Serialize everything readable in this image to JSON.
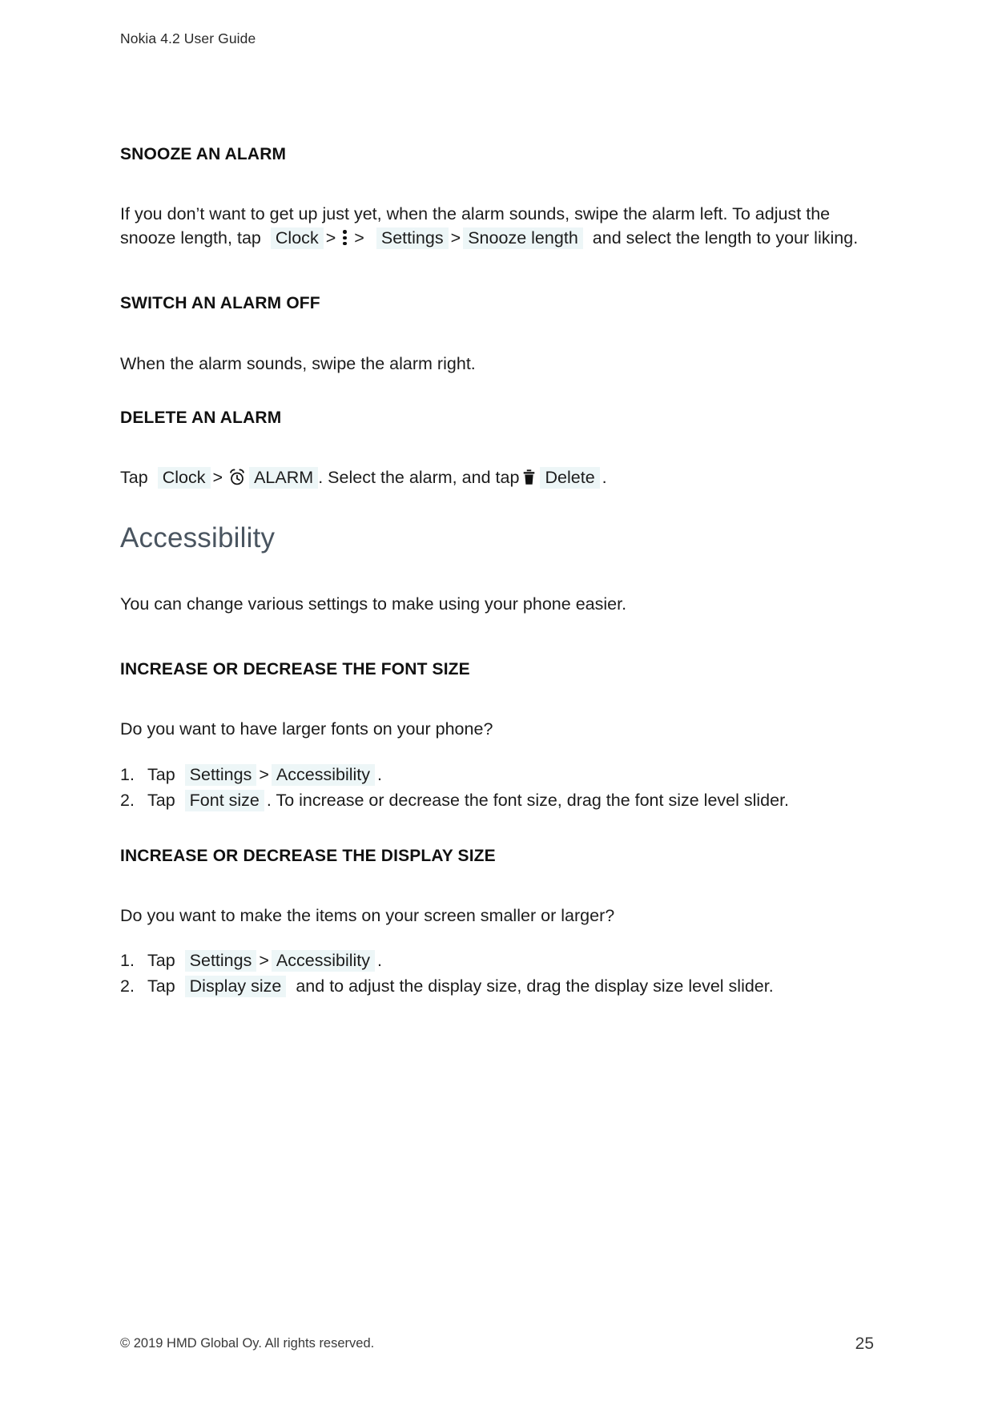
{
  "document": {
    "running_header": "Nokia 4.2 User Guide",
    "page_number": "25",
    "copyright": "© 2019 HMD Global Oy. All rights reserved."
  },
  "colors": {
    "ui_reference_highlight": "#edf6f7",
    "section_title": "#4a5560",
    "body_text": "#1c1c1c",
    "page_background": "#ffffff"
  },
  "sections": {
    "snooze_alarm": {
      "heading": "SNOOZE AN ALARM",
      "paragraph": {
        "part1": "If you don’t want to get up just yet, when the alarm sounds, swipe the alarm left. To adjust the snooze length, tap",
        "ref1": "Clock",
        "sep1": ">",
        "icon1": "overflow-menu-icon",
        "sep2": ">",
        "ref2": "Settings",
        "sep3": ">",
        "ref3": "Snooze length",
        "part2": "and select the length to your liking."
      }
    },
    "switch_alarm_off": {
      "heading": "SWITCH AN ALARM OFF",
      "paragraph": "When the alarm sounds, swipe the alarm right."
    },
    "delete_alarm": {
      "heading": "DELETE AN ALARM",
      "paragraph": {
        "part1": "Tap",
        "ref1": "Clock",
        "sep1": ">",
        "icon1": "alarm-clock-icon",
        "ref2": "ALARM",
        "part2": ". Select the alarm, and tap",
        "icon2": "trash-icon",
        "ref3": "Delete",
        "part3": "."
      }
    },
    "accessibility": {
      "heading": "Accessibility",
      "intro": "You can change various settings to make using your phone easier."
    },
    "font_size": {
      "heading": "INCREASE OR DECREASE THE FONT SIZE",
      "intro": "Do you want to have larger fonts on your phone?",
      "steps": [
        {
          "num": "1.",
          "part1": "Tap",
          "ref1": "Settings",
          "sep1": ">",
          "ref2": "Accessibility",
          "part2": "."
        },
        {
          "num": "2.",
          "part1": "Tap",
          "ref1": "Font size",
          "part2": ". To increase or decrease the font size, drag the font size level slider."
        }
      ]
    },
    "display_size": {
      "heading": "INCREASE OR DECREASE THE DISPLAY SIZE",
      "intro": "Do you want to make the items on your screen smaller or larger?",
      "steps": [
        {
          "num": "1.",
          "part1": "Tap",
          "ref1": "Settings",
          "sep1": ">",
          "ref2": "Accessibility",
          "part2": "."
        },
        {
          "num": "2.",
          "part1": "Tap",
          "ref1": "Display size",
          "part2": "and to adjust the display size, drag the display size level slider."
        }
      ]
    }
  }
}
